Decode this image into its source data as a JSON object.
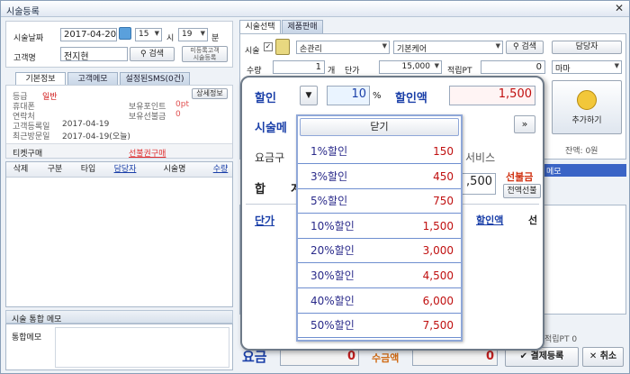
{
  "window": {
    "title": "시술등록",
    "close": "✕"
  },
  "left": {
    "date_label": "시술날짜",
    "date_value": "2017-04-20",
    "hour_value": "15",
    "hour_unit": "시",
    "minute_value": "19",
    "minute_unit": "분",
    "customer_label": "고객명",
    "customer_value": "전지현",
    "search_btn": "검색",
    "unreg_btn_line1": "미등록고객",
    "unreg_btn_line2": "시술등록",
    "tabs": [
      "기본정보",
      "고객메모",
      "설정된SMS(0건)"
    ],
    "detail_btn": "상세정보",
    "info": {
      "grade_label": "등급",
      "grade_value": "일반",
      "mobile_label": "휴대폰",
      "contact_label": "연락처",
      "points_label": "보유포인트",
      "points_value": "0pt",
      "prepaid_label": "보유선불금",
      "prepaid_value": "0",
      "regdate_label": "고객등록일",
      "regdate_value": "2017-04-19",
      "lastvisit_label": "최근방문일",
      "lastvisit_value": "2017-04-19(오늘)"
    },
    "ticket_label": "티켓구매",
    "ticket_link": "선불권구매",
    "grid_headers": [
      "삭제",
      "구분",
      "타입",
      "담당자",
      "시술명",
      "수량"
    ],
    "memo_title": "시술 통합 메모",
    "memo_label": "통합메모"
  },
  "right": {
    "tabs": [
      "시술선택",
      "제품판매"
    ],
    "staff_btn": "담당자",
    "service_label": "시술",
    "cat1": "손관리",
    "cat2": "기본케어",
    "search_btn": "검색",
    "qty_label": "수량",
    "qty_value": "1",
    "qty_unit": "개",
    "price_label": "단가",
    "price_value": "15,000",
    "earn_label": "적립PT",
    "earn_value": "0",
    "staff_value": "마마",
    "add_btn": "추가하기",
    "balance_text": "잔액: 0원",
    "partial_memo": "메모",
    "grid_discount_hdr": "할인액",
    "grid_first_hdr": "선",
    "earn_pt_text": "적립PT 0",
    "bottom_discount_label": "요금",
    "bottom_zero1": "0",
    "bottom_final_label": "수금액",
    "bottom_zero2": "0",
    "pay_btn": "결제등록",
    "cancel_btn": "취소"
  },
  "popup": {
    "discount_label": "할인",
    "discount_pct": "10",
    "pct_unit": "%",
    "discount_amt_label": "할인액",
    "discount_amt": "1,500",
    "service_memo_label": "시술메",
    "fee_label": "요금구",
    "service_text": "서비스",
    "total_label": "합",
    "total_label2": "계",
    "total_value": ",500",
    "prepaid_label": "선불금",
    "remain_btn": "전액선불",
    "more_btn": "»",
    "close_btn": "닫기",
    "unit_hdr": "단가"
  },
  "discount_options": [
    {
      "name": "1%할인",
      "value": "150"
    },
    {
      "name": "3%할인",
      "value": "450"
    },
    {
      "name": "5%할인",
      "value": "750"
    },
    {
      "name": "10%할인",
      "value": "1,500"
    },
    {
      "name": "20%할인",
      "value": "3,000"
    },
    {
      "name": "30%할인",
      "value": "4,500"
    },
    {
      "name": "40%할인",
      "value": "6,000"
    },
    {
      "name": "50%할인",
      "value": "7,500"
    }
  ]
}
